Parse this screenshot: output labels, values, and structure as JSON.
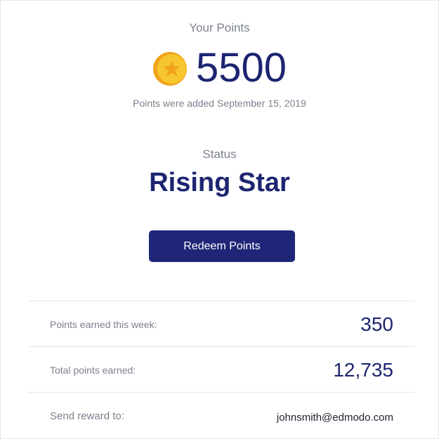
{
  "header": {
    "title": "Your Points",
    "points": "5500",
    "added_note": "Points were added September 15, 2019"
  },
  "status": {
    "label": "Status",
    "value": "Rising Star"
  },
  "actions": {
    "redeem_label": "Redeem Points"
  },
  "summary": {
    "rows": [
      {
        "label": "Points earned this week:",
        "value": "350"
      },
      {
        "label": "Total points earned:",
        "value": "12,735"
      },
      {
        "label": "Send reward to:",
        "value": "johnsmith@edmodo.com"
      }
    ]
  },
  "icons": {
    "coin": "coin-star-icon"
  },
  "colors": {
    "primary": "#1d2571",
    "button": "#1f2678",
    "muted_text": "#7d8290",
    "coin_gold": "#f7c52d",
    "coin_orange": "#f0a21a",
    "divider": "#e3e5ea"
  }
}
